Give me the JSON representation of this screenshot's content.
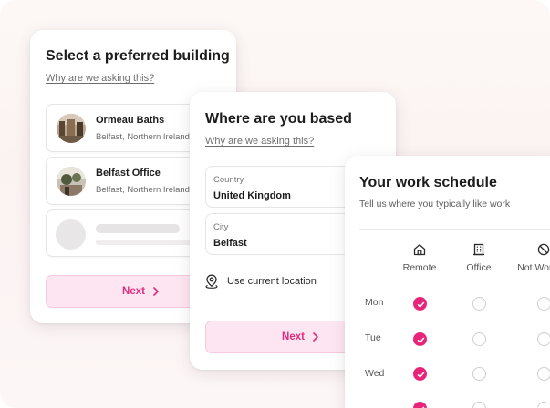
{
  "building_card": {
    "title": "Select a preferred building",
    "why_link": "Why are we asking this?",
    "buildings": [
      {
        "name": "Ormeau Baths",
        "address": "Belfast, Northern Ireland"
      },
      {
        "name": "Belfast Office",
        "address": "Belfast, Northern Ireland"
      }
    ],
    "next_label": "Next"
  },
  "location_card": {
    "title": "Where are you based",
    "why_link": "Why are we asking this?",
    "country": {
      "label": "Country",
      "value": "United Kingdom"
    },
    "city": {
      "label": "City",
      "value": "Belfast"
    },
    "use_location_label": "Use current location",
    "next_label": "Next"
  },
  "schedule_card": {
    "title": "Your work schedule",
    "subtitle": "Tell us where you typically like work",
    "columns": [
      {
        "label": "Remote",
        "icon": "home-icon"
      },
      {
        "label": "Office",
        "icon": "building-icon"
      },
      {
        "label": "Not Working",
        "icon": "block-icon"
      }
    ],
    "rows": [
      {
        "day": "Mon",
        "selected": "Remote"
      },
      {
        "day": "Tue",
        "selected": "Remote"
      },
      {
        "day": "Wed",
        "selected": "Remote"
      },
      {
        "day": "",
        "selected": "Remote"
      }
    ]
  },
  "colors": {
    "accent": "#e8247a",
    "button_bg": "#fde6f1",
    "button_text": "#de2d7f"
  }
}
